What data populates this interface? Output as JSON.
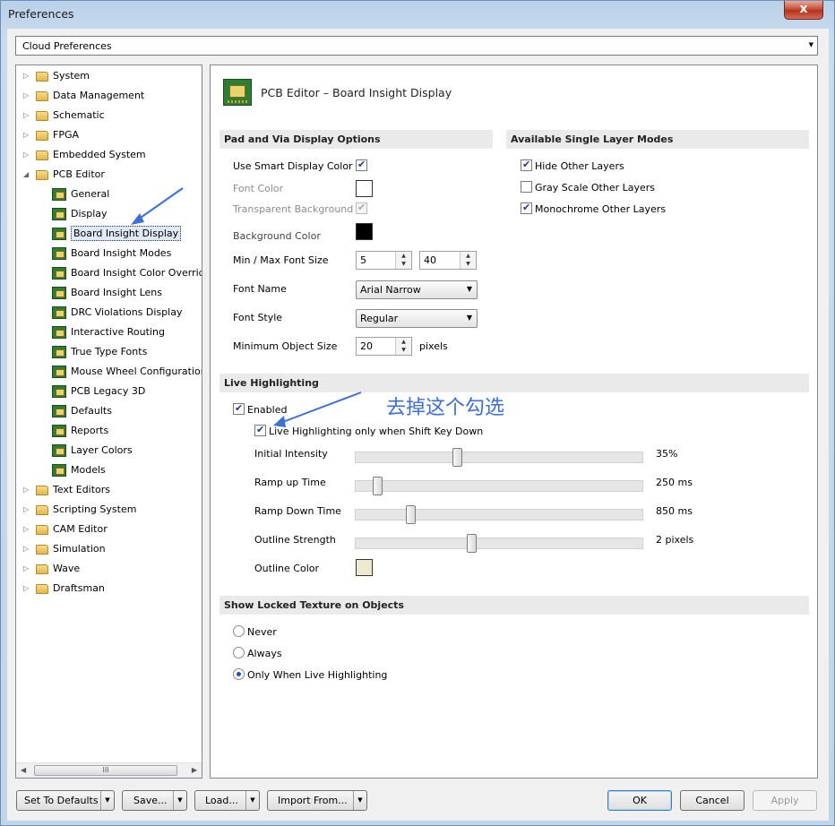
{
  "window": {
    "title": "Preferences",
    "close_glyph": "x"
  },
  "cloud_select": {
    "value": "Cloud Preferences"
  },
  "tree": [
    {
      "label": "System",
      "level": 0,
      "type": "folder",
      "exp": "▷"
    },
    {
      "label": "Data Management",
      "level": 0,
      "type": "folder",
      "exp": "▷"
    },
    {
      "label": "Schematic",
      "level": 0,
      "type": "folder",
      "exp": "▷"
    },
    {
      "label": "FPGA",
      "level": 0,
      "type": "folder",
      "exp": "▷"
    },
    {
      "label": "Embedded System",
      "level": 0,
      "type": "folder",
      "exp": "▷"
    },
    {
      "label": "PCB Editor",
      "level": 0,
      "type": "folder",
      "exp": "◢"
    },
    {
      "label": "General",
      "level": 1,
      "type": "pcb"
    },
    {
      "label": "Display",
      "level": 1,
      "type": "pcb"
    },
    {
      "label": "Board Insight Display",
      "level": 1,
      "type": "pcb",
      "selected": true
    },
    {
      "label": "Board Insight Modes",
      "level": 1,
      "type": "pcb"
    },
    {
      "label": "Board Insight Color Overrid",
      "level": 1,
      "type": "pcb"
    },
    {
      "label": "Board Insight Lens",
      "level": 1,
      "type": "pcb"
    },
    {
      "label": "DRC Violations Display",
      "level": 1,
      "type": "pcb"
    },
    {
      "label": "Interactive Routing",
      "level": 1,
      "type": "pcb"
    },
    {
      "label": "True Type Fonts",
      "level": 1,
      "type": "pcb"
    },
    {
      "label": "Mouse Wheel Configuration",
      "level": 1,
      "type": "pcb"
    },
    {
      "label": "PCB Legacy 3D",
      "level": 1,
      "type": "pcb"
    },
    {
      "label": "Defaults",
      "level": 1,
      "type": "pcb"
    },
    {
      "label": "Reports",
      "level": 1,
      "type": "pcb"
    },
    {
      "label": "Layer Colors",
      "level": 1,
      "type": "pcb"
    },
    {
      "label": "Models",
      "level": 1,
      "type": "pcb"
    },
    {
      "label": "Text Editors",
      "level": 0,
      "type": "folder",
      "exp": "▷"
    },
    {
      "label": "Scripting System",
      "level": 0,
      "type": "folder",
      "exp": "▷"
    },
    {
      "label": "CAM Editor",
      "level": 0,
      "type": "folder",
      "exp": "▷"
    },
    {
      "label": "Simulation",
      "level": 0,
      "type": "folder",
      "exp": "▷"
    },
    {
      "label": "Wave",
      "level": 0,
      "type": "folder",
      "exp": "▷"
    },
    {
      "label": "Draftsman",
      "level": 0,
      "type": "folder",
      "exp": "▷"
    }
  ],
  "tree_scroll": {
    "left": "◀",
    "right": "▶",
    "grip": "III"
  },
  "page": {
    "title": "PCB Editor – Board Insight Display"
  },
  "pad_via": {
    "header": "Pad and Via Display Options",
    "smart_color": {
      "label": "Use Smart Display Color",
      "checked": true
    },
    "font_color": {
      "label": "Font Color",
      "color": "#ffffff"
    },
    "transparent_bg": {
      "label": "Transparent Background",
      "checked": true
    },
    "bg_color": {
      "label": "Background Color",
      "color": "#000000"
    },
    "font_size": {
      "label": "Min / Max Font Size",
      "min": "5",
      "max": "40"
    },
    "font_name": {
      "label": "Font Name",
      "value": "Arial Narrow"
    },
    "font_style": {
      "label": "Font Style",
      "value": "Regular"
    },
    "min_obj": {
      "label": "Minimum Object Size",
      "value": "20",
      "unit": "pixels"
    }
  },
  "single_layer": {
    "header": "Available Single Layer Modes",
    "options": [
      {
        "label": "Hide Other Layers",
        "checked": true
      },
      {
        "label": "Gray Scale Other Layers",
        "checked": false
      },
      {
        "label": "Monochrome Other Layers",
        "checked": true
      }
    ]
  },
  "live": {
    "header": "Live Highlighting",
    "enabled": {
      "label": "Enabled",
      "checked": true
    },
    "shift_only": {
      "label": "Live Highlighting only when Shift Key Down",
      "checked": true
    },
    "sliders": [
      {
        "label": "Initial Intensity",
        "value_text": "35%",
        "fraction": 0.35
      },
      {
        "label": "Ramp up Time",
        "value_text": "250 ms",
        "fraction": 0.06
      },
      {
        "label": "Ramp Down Time",
        "value_text": "850 ms",
        "fraction": 0.18
      },
      {
        "label": "Outline Strength",
        "value_text": "2 pixels",
        "fraction": 0.4
      }
    ],
    "outline_color": {
      "label": "Outline Color",
      "color": "#ecebd0"
    }
  },
  "annotation": {
    "text": "去掉这个勾选",
    "color": "#3d6fd6"
  },
  "locked": {
    "header": "Show Locked Texture on Objects",
    "options": [
      {
        "label": "Never",
        "selected": false
      },
      {
        "label": "Always",
        "selected": false
      },
      {
        "label": "Only When Live Highlighting",
        "selected": true
      }
    ]
  },
  "buttons": {
    "set_defaults": "Set To Defaults",
    "save": "Save...",
    "load": "Load...",
    "import": "Import From...",
    "dropdown_glyph": "▼",
    "ok": "OK",
    "cancel": "Cancel",
    "apply": "Apply"
  },
  "colors": {
    "accent": "#3d6fd6",
    "selection": "#dfe8f5"
  }
}
